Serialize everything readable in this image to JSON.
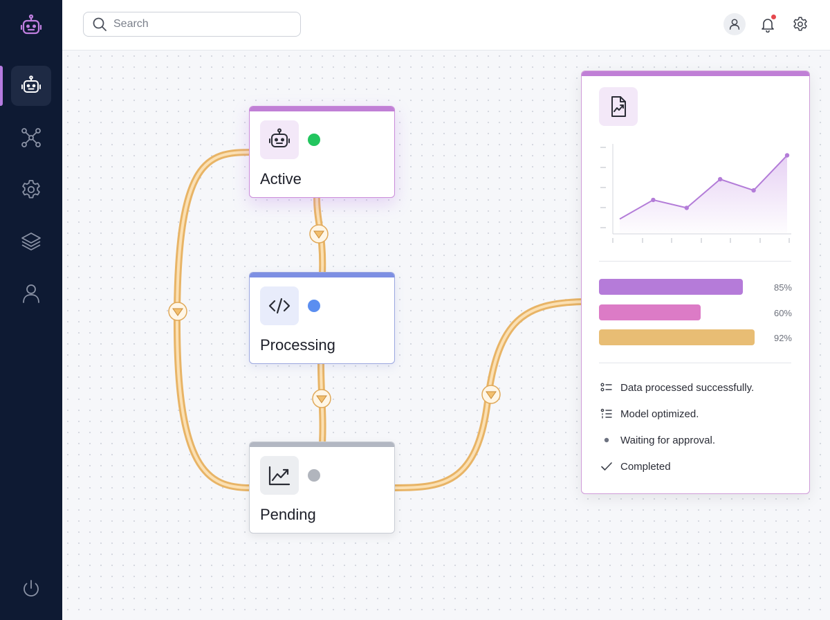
{
  "search": {
    "placeholder": "Search"
  },
  "sidebar": {
    "logo": "robot-icon",
    "items": [
      {
        "icon": "robot-icon",
        "active": true
      },
      {
        "icon": "network-icon",
        "active": false
      },
      {
        "icon": "gear-icon",
        "active": false
      },
      {
        "icon": "layers-icon",
        "active": false
      },
      {
        "icon": "user-icon",
        "active": false
      }
    ],
    "footer_icon": "power-icon"
  },
  "header": {
    "icons": [
      "user-icon",
      "bell-icon",
      "gear-icon"
    ],
    "notification_dot_color": "#e5484d"
  },
  "nodes": [
    {
      "label": "Active",
      "icon": "robot-icon",
      "status_color": "#22c55e",
      "accent": "#c07fd6"
    },
    {
      "label": "Processing",
      "icon": "code-icon",
      "status_color": "#5b8ef0",
      "accent": "#7d8fe3"
    },
    {
      "label": "Pending",
      "icon": "trend-chart-icon",
      "status_color": "#b1b5bd",
      "accent": "#b2b7c2"
    }
  ],
  "panel": {
    "icon": "file-chart-icon",
    "line_chart": {
      "values": [
        1.0,
        3.4,
        2.4,
        6.0,
        4.6,
        9.0
      ]
    },
    "progress": [
      {
        "value": 85,
        "label": "85%",
        "color": "#b57bd9"
      },
      {
        "value": 60,
        "label": "60%",
        "color": "#dc7bc6"
      },
      {
        "value": 92,
        "label": "92%",
        "color": "#e8bd74"
      }
    ],
    "status_items": [
      {
        "icon": "list-icon",
        "text": "Data processed successfully."
      },
      {
        "icon": "list-alt-icon",
        "text": "Model optimized."
      },
      {
        "icon": "dot-icon",
        "text": "Waiting for approval."
      },
      {
        "icon": "check-icon",
        "text": "Completed"
      }
    ]
  },
  "connector_color": "#efc88a"
}
